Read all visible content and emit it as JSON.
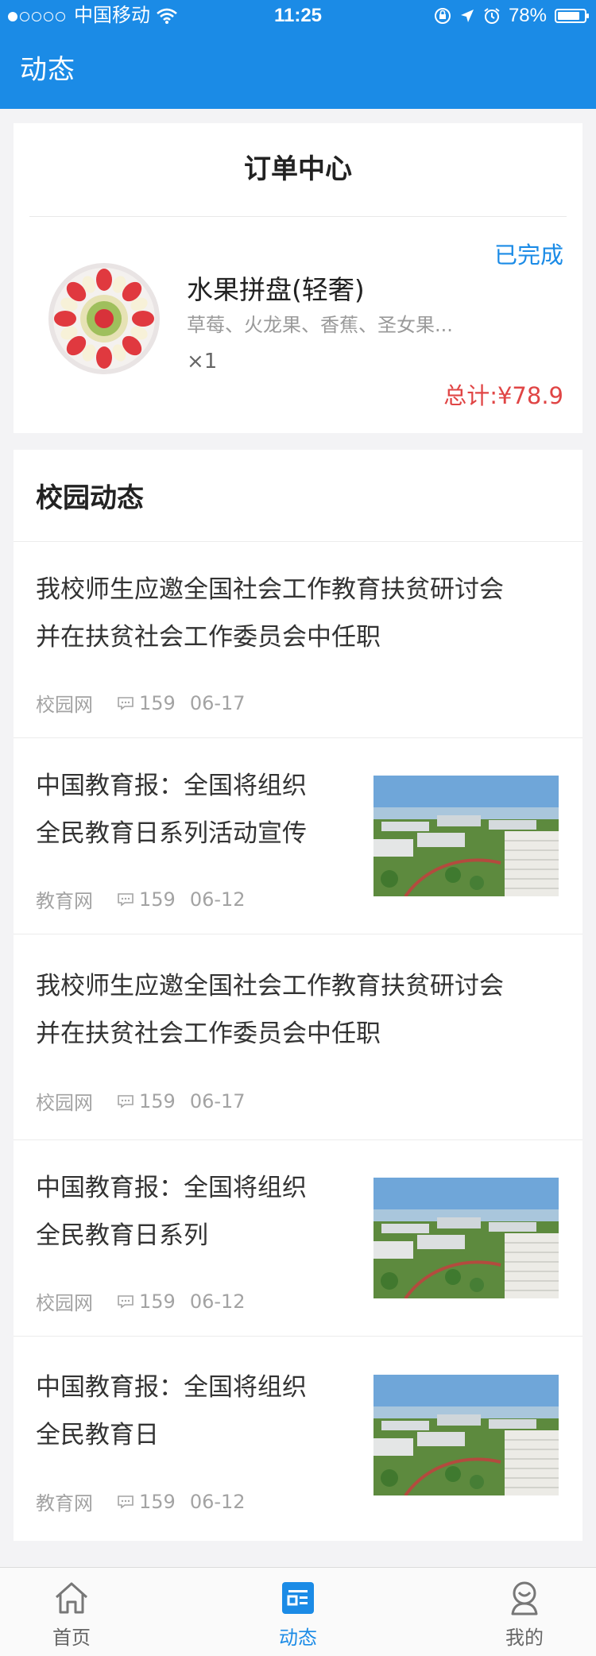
{
  "status_bar": {
    "carrier": "中国移动",
    "time": "11:25",
    "battery": "78%",
    "battery_level": 0.78
  },
  "nav": {
    "title": "动态"
  },
  "order_center": {
    "title": "订单中心",
    "status": "已完成",
    "product_name": "水果拼盘(轻奢)",
    "product_desc": "草莓、火龙果、香蕉、圣女果...",
    "quantity": "×1",
    "total": "总计:¥78.9"
  },
  "campus_news": {
    "title": "校园动态",
    "items": [
      {
        "title_lines": [
          "我校师生应邀全国社会工作教育扶贫研讨会",
          "并在扶贫社会工作委员会中任职"
        ],
        "source": "校园网",
        "comments": "159",
        "date": "06-17",
        "has_image": false
      },
      {
        "title_lines": [
          "中国教育报：全国将组织",
          "全民教育日系列活动宣传"
        ],
        "source": "教育网",
        "comments": "159",
        "date": "06-12",
        "has_image": true
      },
      {
        "title_lines": [
          "我校师生应邀全国社会工作教育扶贫研讨会",
          "并在扶贫社会工作委员会中任职"
        ],
        "source": "校园网",
        "comments": "159",
        "date": "06-17",
        "has_image": false
      },
      {
        "title_lines": [
          "中国教育报：全国将组织",
          "全民教育日系列"
        ],
        "source": "校园网",
        "comments": "159",
        "date": "06-12",
        "has_image": true
      },
      {
        "title_lines": [
          "中国教育报：全国将组织",
          "全民教育日"
        ],
        "source": "教育网",
        "comments": "159",
        "date": "06-12",
        "has_image": true
      }
    ]
  },
  "tabbar": {
    "items": [
      {
        "label": "首页",
        "icon": "home-icon",
        "active": false
      },
      {
        "label": "动态",
        "icon": "news-icon",
        "active": true
      },
      {
        "label": "我的",
        "icon": "profile-icon",
        "active": false
      }
    ]
  },
  "colors": {
    "accent": "#1b8be6",
    "price": "#e04545"
  }
}
